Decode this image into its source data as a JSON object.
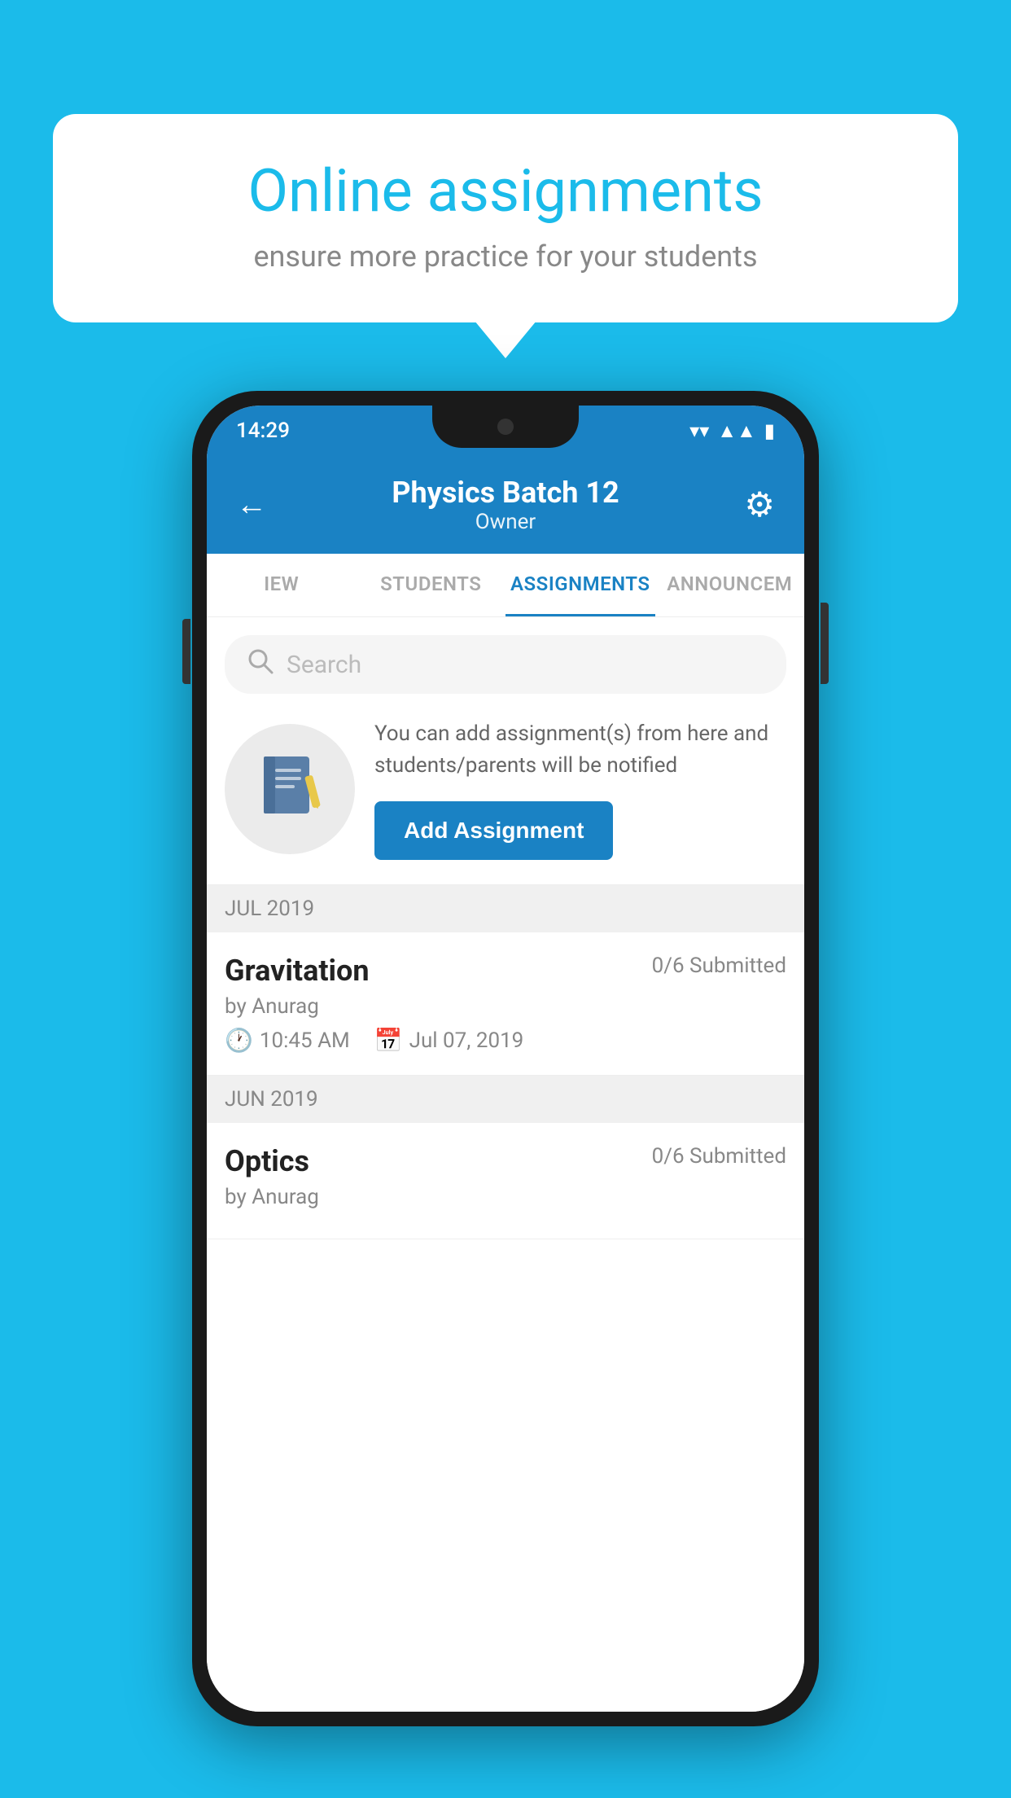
{
  "background": {
    "color": "#1BBBEA"
  },
  "speech_bubble": {
    "title": "Online assignments",
    "subtitle": "ensure more practice for your students"
  },
  "phone": {
    "status_bar": {
      "time": "14:29",
      "icons": [
        "wifi",
        "signal",
        "battery"
      ]
    },
    "header": {
      "title": "Physics Batch 12",
      "subtitle": "Owner",
      "back_label": "←",
      "settings_label": "⚙"
    },
    "tabs": [
      {
        "label": "IEW",
        "active": false
      },
      {
        "label": "STUDENTS",
        "active": false
      },
      {
        "label": "ASSIGNMENTS",
        "active": true
      },
      {
        "label": "ANNOUNCEM",
        "active": false
      }
    ],
    "search": {
      "placeholder": "Search"
    },
    "promo": {
      "text": "You can add assignment(s) from here and students/parents will be notified",
      "button_label": "Add Assignment"
    },
    "sections": [
      {
        "month": "JUL 2019",
        "assignments": [
          {
            "name": "Gravitation",
            "submitted": "0/6 Submitted",
            "by": "by Anurag",
            "time": "10:45 AM",
            "date": "Jul 07, 2019"
          }
        ]
      },
      {
        "month": "JUN 2019",
        "assignments": [
          {
            "name": "Optics",
            "submitted": "0/6 Submitted",
            "by": "by Anurag",
            "time": "",
            "date": ""
          }
        ]
      }
    ]
  }
}
